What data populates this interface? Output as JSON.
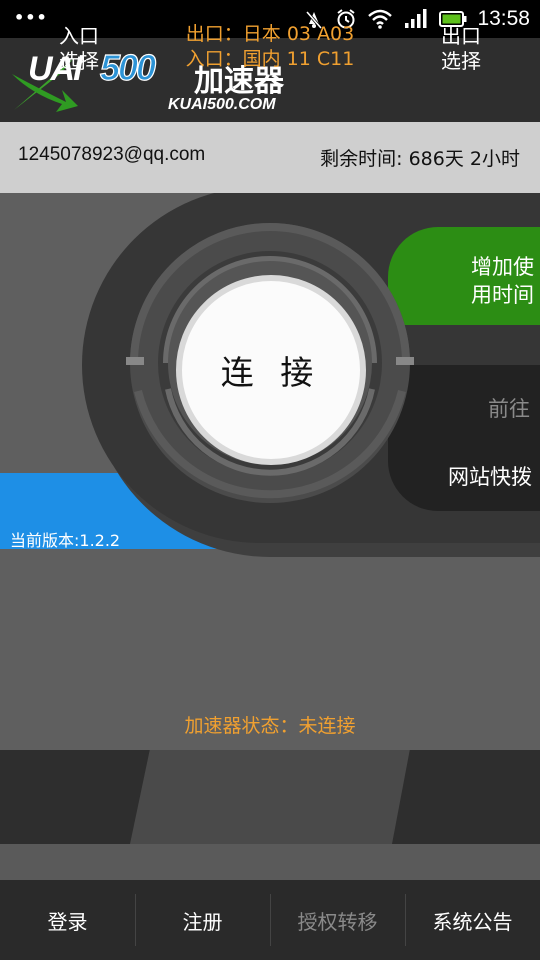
{
  "status_bar": {
    "menu_dots": "•••",
    "time": "13:58",
    "icons": [
      "mute-icon",
      "alarm-icon",
      "wifi-icon",
      "signal-icon",
      "battery-icon"
    ]
  },
  "header": {
    "logo_text": "KUAI500",
    "app_name": "加速器",
    "domain": "KUAI500.COM"
  },
  "account": {
    "email": "1245078923@qq.com",
    "remaining_time": "剩余时间: 686天 2小时"
  },
  "main": {
    "connect_label": "连 接",
    "add_time_label": "增加使用时间",
    "go_label": "前往",
    "website_label": "网站快拨",
    "version": "当前版本:1.2.2",
    "status": "加速器状态：未连接"
  },
  "route": {
    "entry_select": "入口选择",
    "exit_select": "出口选择",
    "exit_info": "出口：日本 03 A03",
    "entry_info": "入口：国内 11 C11"
  },
  "bottom_nav": {
    "login": "登录",
    "register": "注册",
    "transfer": "授权转移",
    "notice": "系统公告"
  },
  "colors": {
    "accent_blue": "#1e8fe6",
    "accent_green": "#2c8d14",
    "status_orange": "#f0a030"
  }
}
